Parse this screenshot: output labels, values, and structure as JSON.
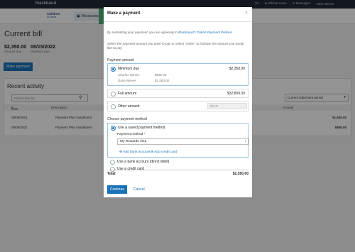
{
  "app": {
    "brand": "blackbaud",
    "topbar": {
      "official_notes": "Official notes",
      "messages": "Messages",
      "user": "John Nieves"
    },
    "logo": {
      "line1": "Children",
      "line2": "of Christ"
    },
    "nav_resources": "Resources"
  },
  "page": {
    "title": "Current bill",
    "amount_value": "$2,350.00",
    "amount_label": "Amount due",
    "due_value": "08/15/2022",
    "due_label": "Payment due",
    "make_payment_button": "Make payment"
  },
  "recent": {
    "title": "Recent activity",
    "filter_placeholder": "Find in this list",
    "period_select": "Current statement period",
    "columns": {
      "date": "Date",
      "description": "Description",
      "amount": "Amount"
    },
    "rows": [
      {
        "date": "08/09/2021",
        "description": "Payment Plan Installment",
        "amount": "$1,500.00"
      },
      {
        "date": "08/09/2021",
        "description": "Payment Plan Installment",
        "amount": "$850.00"
      }
    ]
  },
  "modal": {
    "title": "Make a payment",
    "agree_text": "By submitting your payment, you are agreeing to",
    "agree_link": "Blackbaud's Tuition Payment Policies",
    "instructions": "Select the payment amount you want to pay or select \"Other\" to indicate the amount you would like to pay.",
    "payment_amount_label": "Payment amount",
    "options": {
      "minimum": {
        "label": "Minimum due",
        "amount": "$2,350.00",
        "students": [
          {
            "name": "Charles Nieves",
            "amount": "$850.00"
          },
          {
            "name": "Dana Nieves",
            "amount": "$1,500.00"
          }
        ]
      },
      "full": {
        "label": "Full amount",
        "amount": "$32,800.00"
      },
      "other": {
        "label": "Other amount",
        "placeholder": "$0.00"
      }
    },
    "payment_method_label": "Choose payment method",
    "saved_method_label": "Use a saved payment method",
    "payment_method_field_label": "Payment method",
    "payment_method_selected": "My Rewards Visa",
    "add_bank_account": "Add bank account",
    "add_credit_card": "Add credit card",
    "use_bank_account": "Use a bank account (direct debit)",
    "use_credit_card": "Use a credit card",
    "total_label": "Total",
    "total_value": "$2,350.00",
    "continue_button": "Continue",
    "cancel_button": "Cancel"
  }
}
